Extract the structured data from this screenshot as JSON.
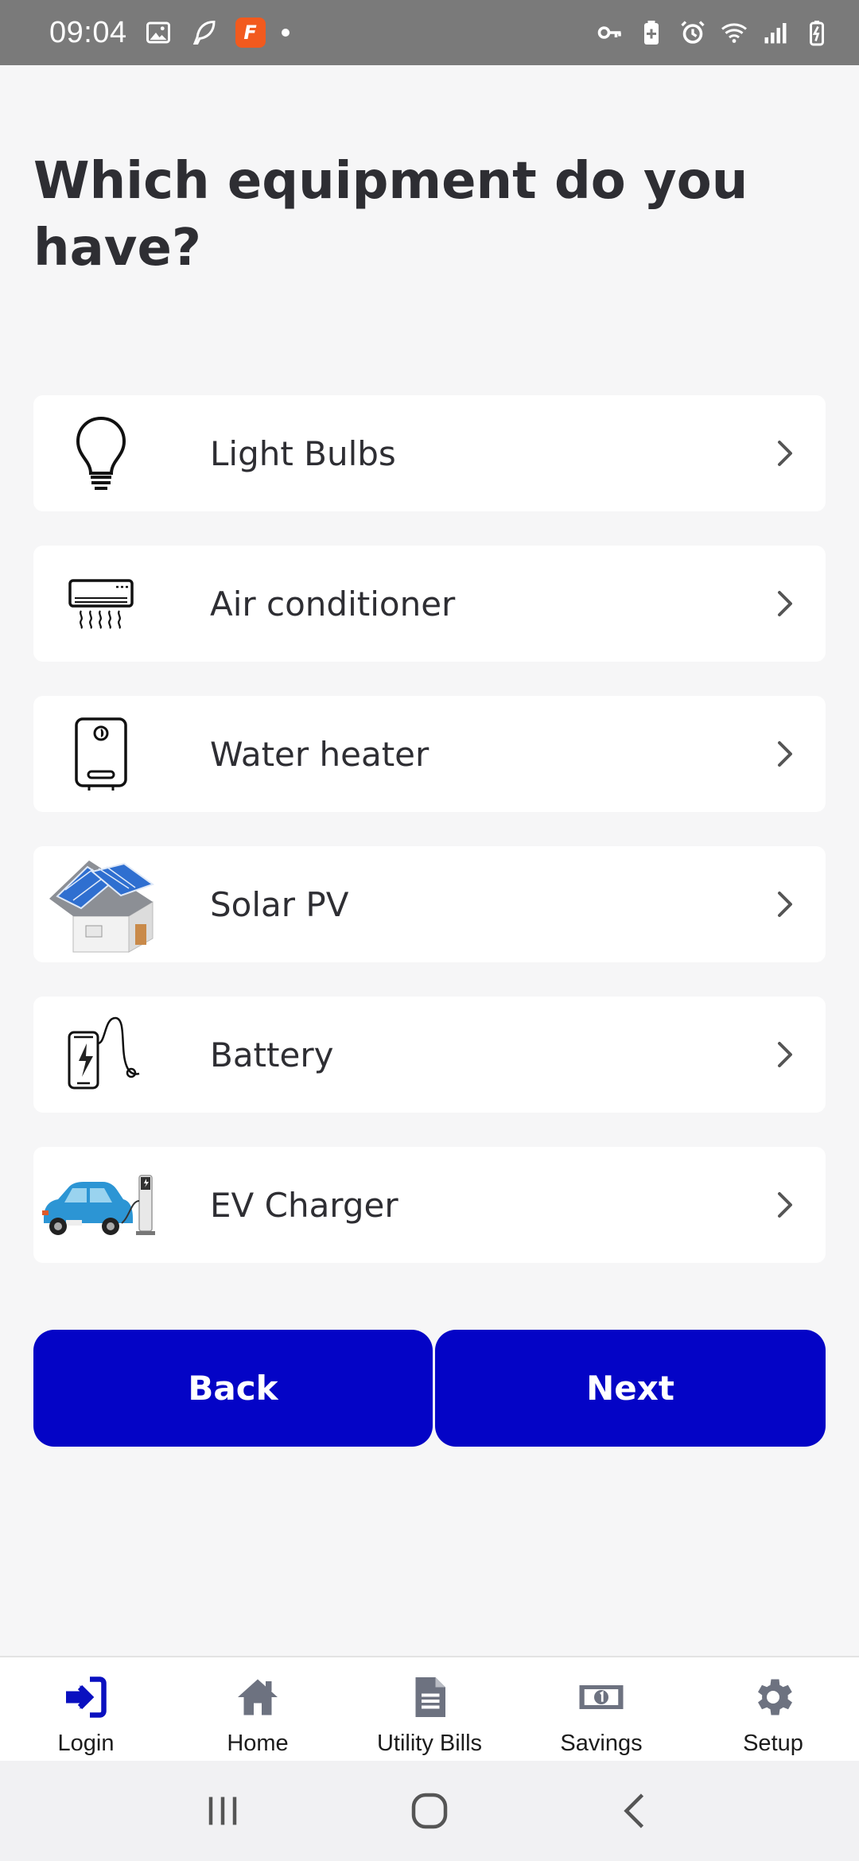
{
  "status_bar": {
    "time": "09:04",
    "app_badge_letter": "F",
    "icons": [
      "image-icon",
      "feather-icon",
      "vpn-key-icon",
      "battery-saver-icon",
      "alarm-icon",
      "wifi-icon",
      "signal-icon",
      "battery-icon"
    ]
  },
  "page": {
    "title": "Which equipment do you have?"
  },
  "equipment": [
    {
      "label": "Light Bulbs",
      "icon": "light-bulb-icon"
    },
    {
      "label": "Air conditioner",
      "icon": "air-conditioner-icon"
    },
    {
      "label": "Water heater",
      "icon": "water-heater-icon"
    },
    {
      "label": "Solar PV",
      "icon": "solar-pv-icon"
    },
    {
      "label": "Battery",
      "icon": "battery-icon"
    },
    {
      "label": "EV Charger",
      "icon": "ev-charger-icon"
    }
  ],
  "buttons": {
    "back": "Back",
    "next": "Next"
  },
  "bottom_nav": [
    {
      "label": "Login",
      "icon": "login-icon"
    },
    {
      "label": "Home",
      "icon": "home-icon"
    },
    {
      "label": "Utility Bills",
      "icon": "document-icon"
    },
    {
      "label": "Savings",
      "icon": "money-icon"
    },
    {
      "label": "Setup",
      "icon": "gear-icon"
    }
  ],
  "colors": {
    "primary": "#0404c6",
    "status_bar": "#7a7a7a",
    "background": "#f6f6f7",
    "text": "#2e2e33",
    "nav_icon_active": "#0a10c0",
    "nav_icon_inactive": "#6d7280"
  }
}
